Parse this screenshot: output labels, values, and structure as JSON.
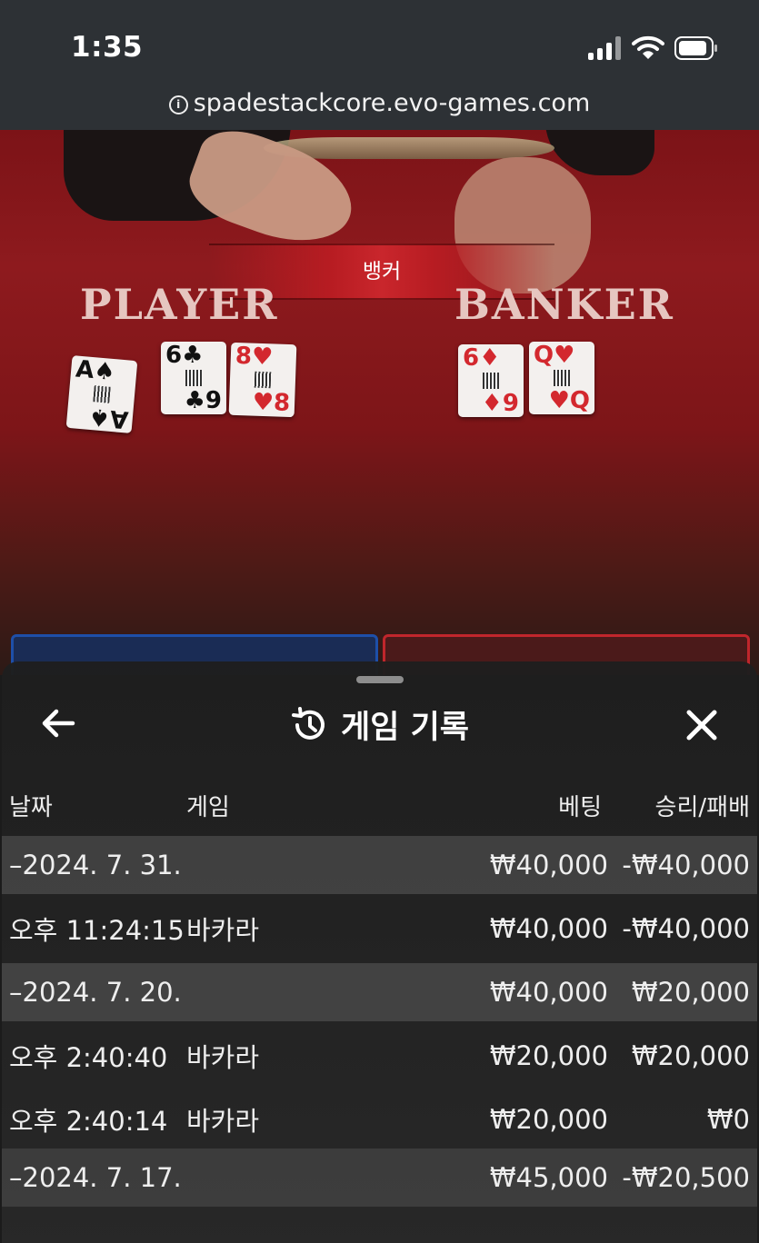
{
  "status_bar": {
    "time": "1:35"
  },
  "browser": {
    "url": "spadestackcore.evo-games.com"
  },
  "game": {
    "result_banner": "뱅커",
    "player_label": "PLAYER",
    "banker_label": "BANKER",
    "player_cards": [
      {
        "rank": "A",
        "suit": "♠",
        "color": "#111111"
      },
      {
        "rank": "6",
        "suit": "♣",
        "color": "#111111",
        "rank2": "9"
      },
      {
        "rank": "8",
        "suit": "♥",
        "color": "#d3282e"
      }
    ],
    "banker_cards": [
      {
        "rank": "6",
        "suit": "♦",
        "color": "#d3282e",
        "rank2": "9"
      },
      {
        "rank": "Q",
        "suit": "♥",
        "color": "#d3282e"
      }
    ]
  },
  "sheet": {
    "title": "게임 기록",
    "icons": {
      "back": "arrow-left-icon",
      "history": "history-icon",
      "close": "close-icon"
    },
    "columns": {
      "date": "날짜",
      "game": "게임",
      "bet": "베팅",
      "win_loss": "승리/패배"
    },
    "rows": [
      {
        "type": "date",
        "date": "–2024. 7. 31.",
        "game": "",
        "bet": "₩40,000",
        "win_loss": "-₩40,000"
      },
      {
        "type": "entry",
        "date": "오후 11:24:15",
        "game": "바카라",
        "bet": "₩40,000",
        "win_loss": "-₩40,000"
      },
      {
        "type": "date",
        "date": "–2024. 7. 20.",
        "game": "",
        "bet": "₩40,000",
        "win_loss": "₩20,000"
      },
      {
        "type": "entry",
        "date": "오후 2:40:40",
        "game": "바카라",
        "bet": "₩20,000",
        "win_loss": "₩20,000"
      },
      {
        "type": "entry",
        "date": "오후 2:40:14",
        "game": "바카라",
        "bet": "₩20,000",
        "win_loss": "₩0"
      },
      {
        "type": "date",
        "date": "–2024. 7. 17.",
        "game": "",
        "bet": "₩45,000",
        "win_loss": "-₩20,500"
      }
    ]
  }
}
